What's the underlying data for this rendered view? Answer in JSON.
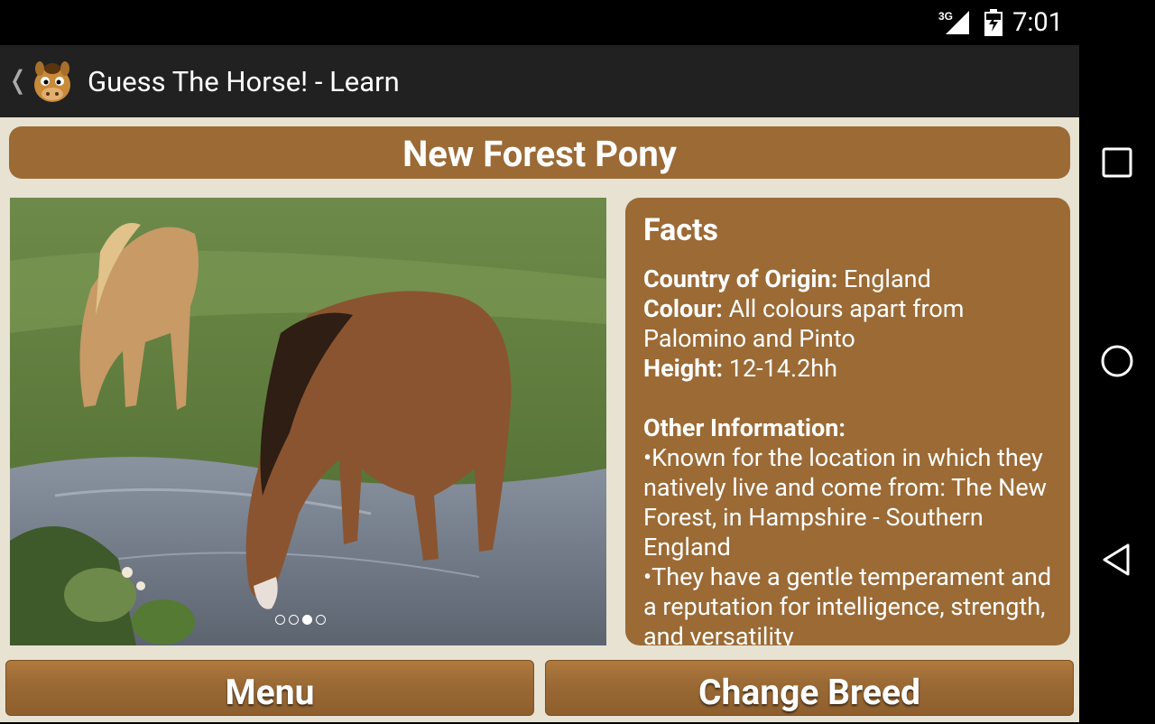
{
  "status_bar": {
    "network": "3G",
    "time": "7:01"
  },
  "action_bar": {
    "title": "Guess The Horse! - Learn"
  },
  "breed": {
    "name": "New Forest Pony"
  },
  "gallery": {
    "image_count": 4,
    "active_index": 2
  },
  "facts": {
    "title": "Facts",
    "country_label": "Country of Origin:",
    "country_value": " England",
    "colour_label": "Colour:",
    "colour_value": " All colours apart from Palomino and Pinto",
    "height_label": "Height:",
    "height_value": " 12-14.2hh",
    "other_label": "Other Information:",
    "other_items": [
      "•Known for the location in which they natively live and come from: The New Forest, in Hampshire - Southern England",
      "•They have a gentle temperament and a reputation for intelligence, strength, and versatility"
    ]
  },
  "buttons": {
    "menu": "Menu",
    "change_breed": "Change Breed"
  },
  "colors": {
    "brown": "#9b6a35",
    "background": "#e8e2d2",
    "action_bar": "#212121"
  }
}
